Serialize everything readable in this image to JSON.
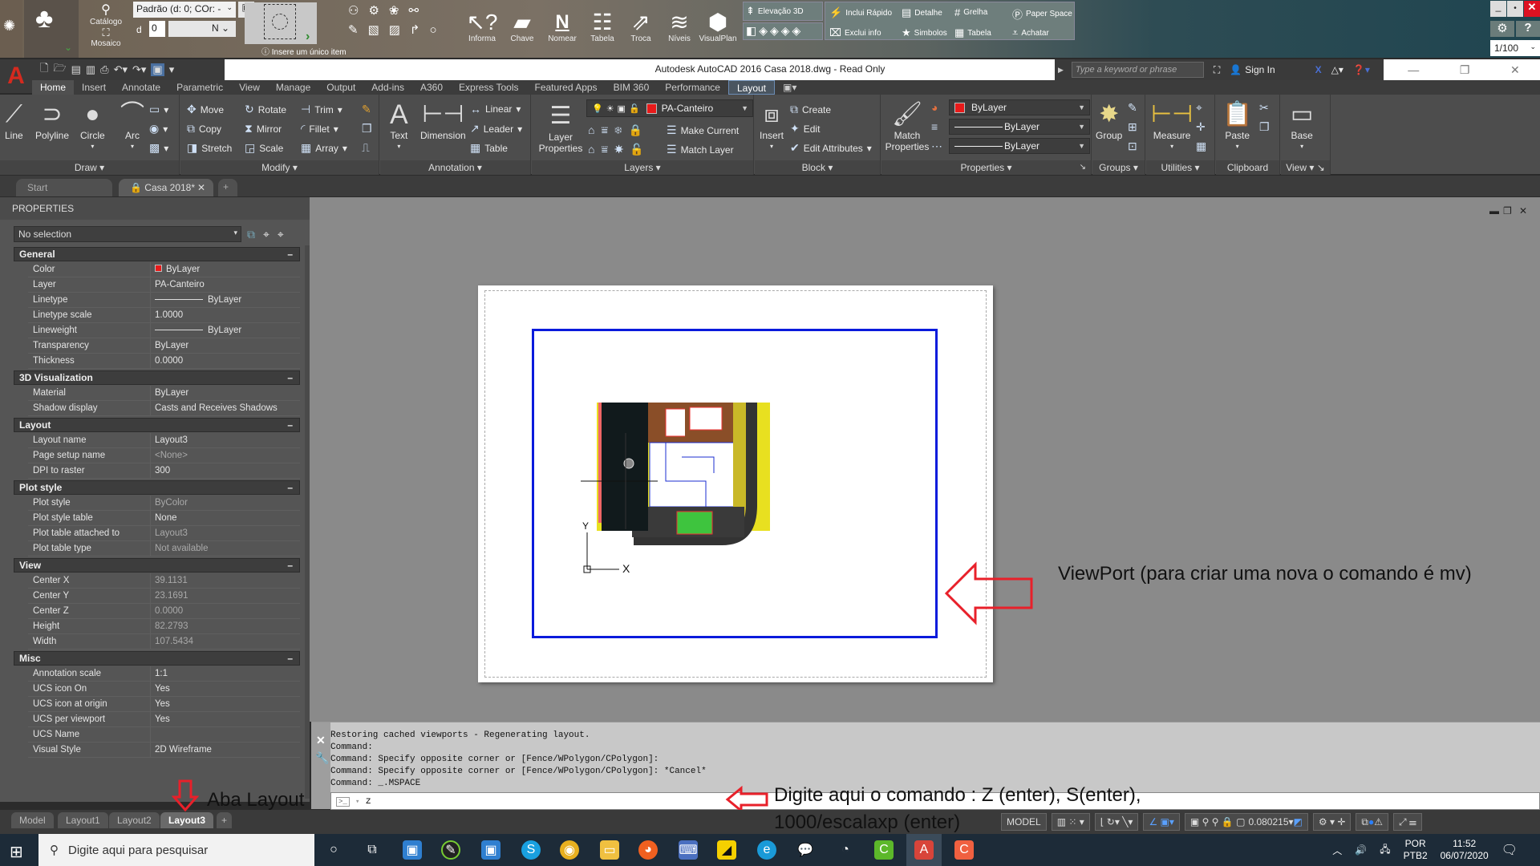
{
  "plugin_toolbar": {
    "library_label_1": "Catálogo",
    "library_label_2": "Mosaico",
    "style_select": "Padrão (d: 0; COr: -",
    "d_label": "d",
    "d_value": "0",
    "n_select": "N",
    "hint": "Insere um único item",
    "tools": [
      "Informa",
      "Chave",
      "Nomear",
      "Tabela",
      "Troca",
      "Níveis",
      "VisualPlan"
    ],
    "group_right": [
      {
        "label": "Elevação 3D",
        "icon": "elevation-icon"
      },
      {
        "label": "Inclui Rápido",
        "icon": "quick-include-icon"
      },
      {
        "label": "Detalhe",
        "icon": "detail-icon"
      },
      {
        "label": "Grelha",
        "icon": "grid-icon"
      },
      {
        "label": "Paper Space",
        "icon": "paper-space-icon"
      },
      {
        "label": "Exclui info",
        "icon": "exclude-info-icon"
      },
      {
        "label": "Simbolos",
        "icon": "star-icon"
      },
      {
        "label": "Tabela",
        "icon": "table-icon"
      },
      {
        "label": "Achatar",
        "icon": "flatten-icon"
      }
    ],
    "scale_select": "1/100"
  },
  "titlebar": {
    "title": "Autodesk AutoCAD 2016    Casa 2018.dwg - Read Only",
    "search_placeholder": "Type a keyword or phrase",
    "sign_in": "Sign In"
  },
  "ribbon_tabs": [
    "Home",
    "Insert",
    "Annotate",
    "Parametric",
    "View",
    "Manage",
    "Output",
    "Add-ins",
    "A360",
    "Express Tools",
    "Featured Apps",
    "BIM 360",
    "Performance",
    "Layout"
  ],
  "ribbon_active_tab": "Home",
  "ribbon": {
    "draw": {
      "title": "Draw",
      "line": "Line",
      "polyline": "Polyline",
      "circle": "Circle",
      "arc": "Arc"
    },
    "modify": {
      "title": "Modify",
      "move": "Move",
      "rotate": "Rotate",
      "trim": "Trim",
      "copy": "Copy",
      "mirror": "Mirror",
      "fillet": "Fillet",
      "stretch": "Stretch",
      "scale": "Scale",
      "array": "Array"
    },
    "annotation": {
      "title": "Annotation",
      "text": "Text",
      "dimension": "Dimension",
      "linear": "Linear",
      "leader": "Leader",
      "table": "Table"
    },
    "layers": {
      "title": "Layers",
      "layer_properties": "Layer Properties",
      "current_layer": "PA-Canteiro",
      "make_current": "Make Current",
      "match_layer": "Match Layer"
    },
    "block": {
      "title": "Block",
      "insert": "Insert",
      "create": "Create",
      "edit": "Edit",
      "edit_attributes": "Edit Attributes"
    },
    "properties": {
      "title": "Properties",
      "match_properties": "Match Properties",
      "color": "ByLayer",
      "linetype": "ByLayer",
      "lineweight": "ByLayer",
      "color_hex": "#e81a1a"
    },
    "groups": {
      "title": "Groups",
      "group": "Group"
    },
    "utilities": {
      "title": "Utilities",
      "measure": "Measure"
    },
    "clipboard": {
      "title": "Clipboard",
      "paste": "Paste"
    },
    "view": {
      "title": "View",
      "base": "Base"
    }
  },
  "file_tabs": [
    {
      "label": "Start"
    },
    {
      "label": "Casa 2018*",
      "active": true
    }
  ],
  "properties_panel": {
    "title": "PROPERTIES",
    "selection": "No selection",
    "categories": [
      {
        "name": "General",
        "rows": [
          {
            "k": "Color",
            "v": "ByLayer"
          },
          {
            "k": "Layer",
            "v": "PA-Canteiro"
          },
          {
            "k": "Linetype",
            "v": "ByLayer"
          },
          {
            "k": "Linetype scale",
            "v": "1.0000"
          },
          {
            "k": "Lineweight",
            "v": "ByLayer"
          },
          {
            "k": "Transparency",
            "v": "ByLayer"
          },
          {
            "k": "Thickness",
            "v": "0.0000"
          }
        ]
      },
      {
        "name": "3D Visualization",
        "rows": [
          {
            "k": "Material",
            "v": "ByLayer"
          },
          {
            "k": "Shadow display",
            "v": "Casts and Receives Shadows"
          }
        ]
      },
      {
        "name": "Layout",
        "rows": [
          {
            "k": "Layout name",
            "v": "Layout3"
          },
          {
            "k": "Page setup name",
            "v": "<None>"
          },
          {
            "k": "DPI to raster",
            "v": "300"
          }
        ]
      },
      {
        "name": "Plot style",
        "rows": [
          {
            "k": "Plot style",
            "v": "ByColor"
          },
          {
            "k": "Plot style table",
            "v": "None"
          },
          {
            "k": "Plot table attached to",
            "v": "Layout3"
          },
          {
            "k": "Plot table type",
            "v": "Not available"
          }
        ]
      },
      {
        "name": "View",
        "rows": [
          {
            "k": "Center X",
            "v": "39.1131"
          },
          {
            "k": "Center Y",
            "v": "23.1691"
          },
          {
            "k": "Center Z",
            "v": "0.0000"
          },
          {
            "k": "Height",
            "v": "82.2793"
          },
          {
            "k": "Width",
            "v": "107.5434"
          }
        ]
      },
      {
        "name": "Misc",
        "rows": [
          {
            "k": "Annotation scale",
            "v": "1:1"
          },
          {
            "k": "UCS icon On",
            "v": "Yes"
          },
          {
            "k": "UCS icon at origin",
            "v": "Yes"
          },
          {
            "k": "UCS per viewport",
            "v": "Yes"
          },
          {
            "k": "UCS Name",
            "v": ""
          },
          {
            "k": "Visual Style",
            "v": "2D Wireframe"
          }
        ]
      }
    ]
  },
  "command_line": {
    "history": [
      "Restoring cached viewports - Regenerating layout.",
      "Command:",
      "Command: Specify opposite corner or [Fence/WPolygon/CPolygon]:",
      "Command: Specify opposite corner or [Fence/WPolygon/CPolygon]: *Cancel*",
      "Command: _.MSPACE"
    ],
    "input": "z"
  },
  "layout_tabs": [
    {
      "label": "Model"
    },
    {
      "label": "Layout1"
    },
    {
      "label": "Layout2"
    },
    {
      "label": "Layout3",
      "active": true
    }
  ],
  "status_bar": {
    "mode": "MODEL",
    "scale": "0.080215"
  },
  "annotations": {
    "viewport": "ViewPort (para criar uma nova o comando é mv)",
    "command_1": "Digite aqui o comando : Z (enter), S(enter),",
    "command_2": "1000/escalaxp (enter)",
    "layout_tab": "Aba Layout",
    "arrow_color": "#e8202a"
  },
  "taskbar": {
    "search_placeholder": "Digite aqui para pesquisar",
    "lang_1": "POR",
    "lang_2": "PTB2",
    "time": "11:52",
    "date": "06/07/2020"
  }
}
